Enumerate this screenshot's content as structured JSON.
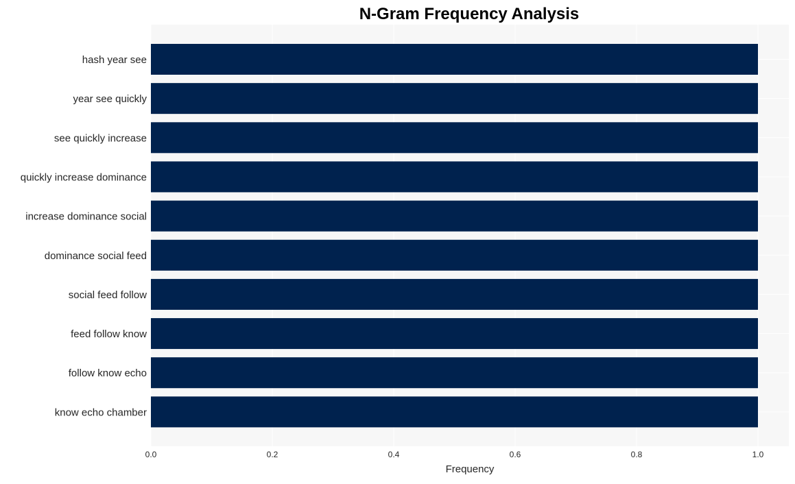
{
  "chart_data": {
    "type": "bar",
    "orientation": "horizontal",
    "title": "N-Gram Frequency Analysis",
    "xlabel": "Frequency",
    "ylabel": "",
    "categories": [
      "hash year see",
      "year see quickly",
      "see quickly increase",
      "quickly increase dominance",
      "increase dominance social",
      "dominance social feed",
      "social feed follow",
      "feed follow know",
      "follow know echo",
      "know echo chamber"
    ],
    "values": [
      1,
      1,
      1,
      1,
      1,
      1,
      1,
      1,
      1,
      1
    ],
    "xlim": [
      0,
      1.05
    ],
    "xticks": [
      "0.0",
      "0.2",
      "0.4",
      "0.6",
      "0.8",
      "1.0"
    ],
    "grid": true,
    "legend": "none",
    "colors": {
      "bar": "#00224e",
      "plot_background": "#f7f7f7",
      "grid": "#ffffff"
    }
  }
}
